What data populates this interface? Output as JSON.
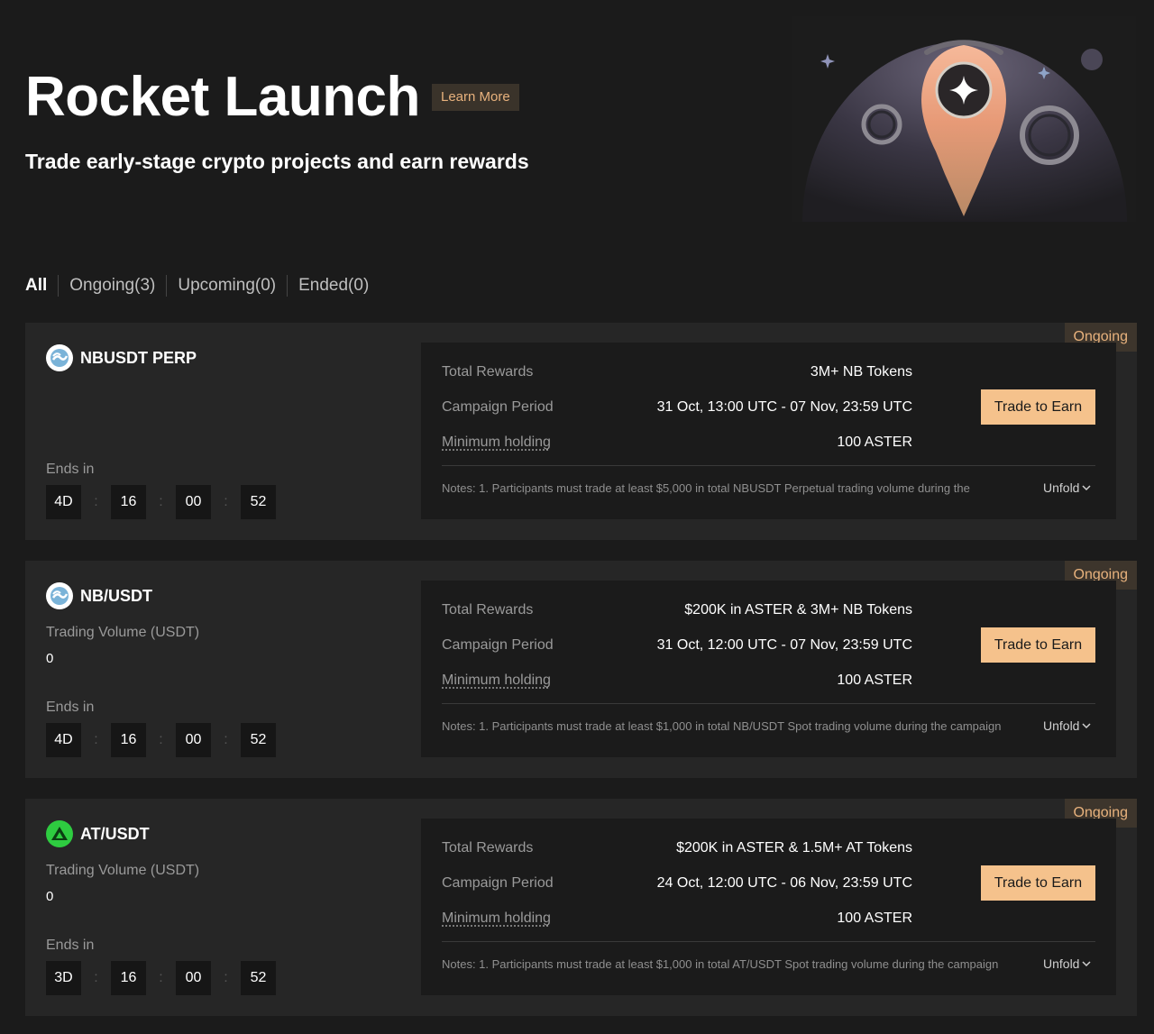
{
  "hero": {
    "title": "Rocket Launch",
    "learn_more": "Learn More",
    "subtitle": "Trade early-stage crypto projects and earn rewards",
    "art_icon": "rocket-pin-planet-illustration"
  },
  "tabs": [
    {
      "label": "All",
      "active": true
    },
    {
      "label": "Ongoing(3)",
      "active": false
    },
    {
      "label": "Upcoming(0)",
      "active": false
    },
    {
      "label": "Ended(0)",
      "active": false
    }
  ],
  "labels": {
    "ends_in": "Ends in",
    "total_rewards": "Total Rewards",
    "campaign_period": "Campaign Period",
    "minimum_holding": "Minimum holding",
    "trade_to_earn": "Trade to Earn",
    "unfold": "Unfold",
    "trading_volume": "Trading Volume (USDT)"
  },
  "colors": {
    "accent": "#f5c28c",
    "accent_text": "#e8b27d",
    "background": "#1b1b1b",
    "card": "#262626",
    "at_logo": "#2ecc40"
  },
  "campaigns": [
    {
      "status": "Ongoing",
      "pair": "NBUSDT PERP",
      "logo": "nb-token-icon",
      "countdown": {
        "days": "4D",
        "hours": "16",
        "minutes": "00",
        "seconds": "52"
      },
      "total_rewards": "3M+ NB Tokens",
      "campaign_period": "31 Oct, 13:00 UTC - 07 Nov, 23:59 UTC",
      "minimum_holding": "100 ASTER",
      "notes": "Notes: 1. Participants must trade at least $5,000 in total NBUSDT Perpetual trading volume during the"
    },
    {
      "status": "Ongoing",
      "pair": "NB/USDT",
      "logo": "nb-token-icon",
      "trading_volume": "0",
      "countdown": {
        "days": "4D",
        "hours": "16",
        "minutes": "00",
        "seconds": "52"
      },
      "total_rewards": "$200K in ASTER & 3M+ NB Tokens",
      "campaign_period": "31 Oct, 12:00 UTC - 07 Nov, 23:59 UTC",
      "minimum_holding": "100 ASTER",
      "notes": "Notes: 1. Participants must trade at least $1,000 in total NB/USDT Spot trading volume during the campaign"
    },
    {
      "status": "Ongoing",
      "pair": "AT/USDT",
      "logo": "at-token-icon",
      "trading_volume": "0",
      "countdown": {
        "days": "3D",
        "hours": "16",
        "minutes": "00",
        "seconds": "52"
      },
      "total_rewards": "$200K in ASTER & 1.5M+ AT Tokens",
      "campaign_period": "24 Oct, 12:00 UTC - 06 Nov, 23:59 UTC",
      "minimum_holding": "100 ASTER",
      "notes": "Notes: 1. Participants must trade at least $1,000 in total AT/USDT Spot trading volume during the campaign"
    }
  ]
}
